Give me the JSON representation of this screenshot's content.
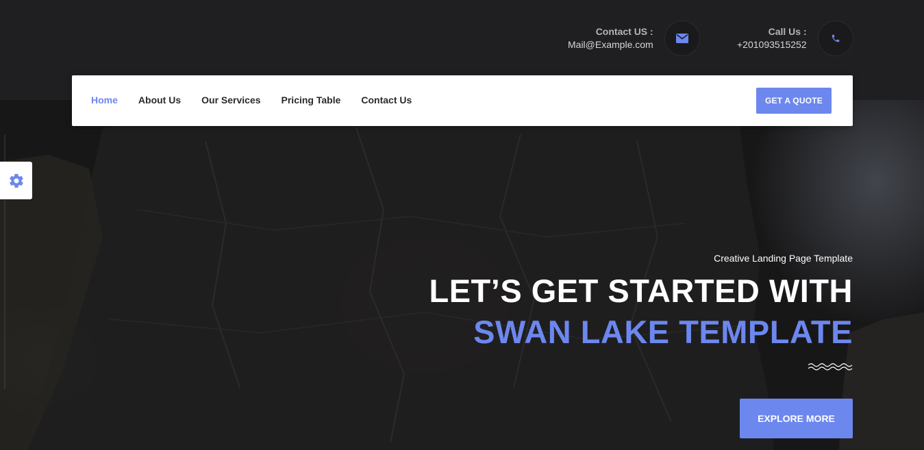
{
  "contact_email": {
    "label": "Contact US :",
    "value": "Mail@Example.com",
    "icon": "envelope-icon"
  },
  "contact_phone": {
    "label": "Call Us :",
    "value": "+201093515252",
    "icon": "phone-icon"
  },
  "nav": {
    "items": [
      {
        "label": "Home",
        "active": true
      },
      {
        "label": "About Us",
        "active": false
      },
      {
        "label": "Our Services",
        "active": false
      },
      {
        "label": "Pricing Table",
        "active": false
      },
      {
        "label": "Contact Us",
        "active": false
      }
    ],
    "cta_label": "GET A QUOTE"
  },
  "settings": {
    "icon": "gear-icon"
  },
  "hero": {
    "subtitle": "Creative Landing Page Template",
    "headline_line1": "LET’S GET STARTED WITH",
    "headline_line2": "SWAN LAKE TEMPLATE",
    "button_label": "EXPLORE MORE"
  },
  "colors": {
    "accent": "#6c87ee",
    "topbar": "#1f1f21",
    "nav_bg": "#ffffff"
  }
}
